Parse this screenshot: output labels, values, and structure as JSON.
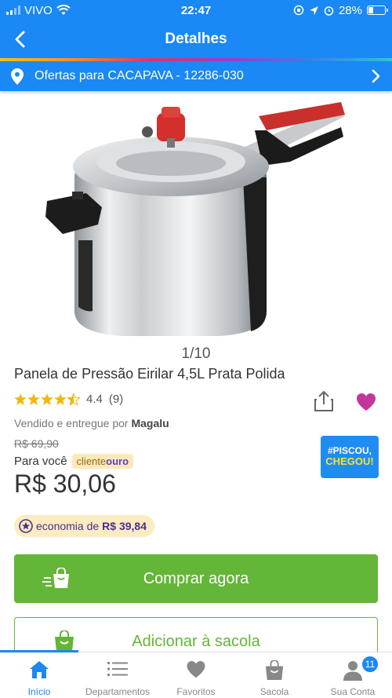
{
  "status_bar": {
    "carrier": "VIVO",
    "time": "22:47",
    "battery_percent": "28%",
    "battery_level": 0.28
  },
  "header": {
    "title": "Detalhes",
    "back_icon": "chevron-left-icon"
  },
  "location": {
    "text": "Ofertas para CACAPAVA - 12286-030",
    "icon": "location-pin-icon"
  },
  "product": {
    "image_counter": "1/10",
    "title": "Panela de Pressão Eirilar 4,5L Prata Polida",
    "rating_value": "4.4",
    "rating_count": "(9)",
    "rating_stars": 4.4,
    "seller_prefix": "Vendido e entregue por",
    "seller_name": "Magalu",
    "old_price": "R$ 69,90",
    "for_you_label": "Para você",
    "cliente_label": "cliente",
    "ouro_label": "ouro",
    "price": "R$ 30,06",
    "economy_label": "economia de",
    "economy_value": "R$ 39,84"
  },
  "promo_badge": {
    "line1": "#PISCOU,",
    "line2": "CHEGOU!"
  },
  "actions": {
    "buy_now": "Comprar agora",
    "add_to_bag": "Adicionar à sacola"
  },
  "bottom_nav": {
    "items": [
      {
        "label": "Início",
        "icon": "home-icon"
      },
      {
        "label": "Departamentos",
        "icon": "list-icon"
      },
      {
        "label": "Favoritos",
        "icon": "heart-icon"
      },
      {
        "label": "Sacola",
        "icon": "bag-icon"
      },
      {
        "label": "Sua Conta",
        "icon": "user-icon"
      }
    ],
    "account_badge": "11"
  },
  "colors": {
    "brand_blue": "#1a88f5",
    "buy_green": "#63b637",
    "favorite_pink": "#c2369b",
    "star_yellow": "#f2b50a"
  }
}
